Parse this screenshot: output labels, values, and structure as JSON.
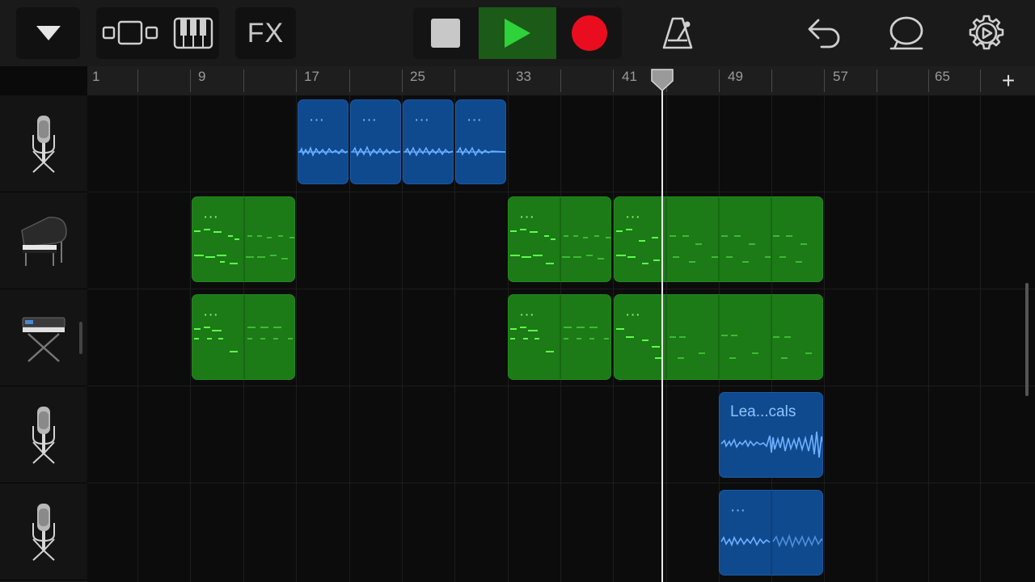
{
  "toolbar": {
    "fx_label": "FX",
    "colors": {
      "play_bg": "#1c5a17",
      "play_icon": "#2ed23a",
      "record": "#ea0d1f",
      "stop": "#c8c8c8"
    }
  },
  "ruler": {
    "bar_numbers": [
      "1",
      "9",
      "17",
      "25",
      "33",
      "41",
      "49",
      "57",
      "65"
    ],
    "add_label": "+"
  },
  "tracks": [
    {
      "instrument": "microphone-icon"
    },
    {
      "instrument": "grand-piano-icon"
    },
    {
      "instrument": "keyboard-synth-icon"
    },
    {
      "instrument": "microphone-icon"
    },
    {
      "instrument": "microphone-icon"
    }
  ],
  "regions": {
    "vocal_1": [
      "···",
      "···",
      "···",
      "···"
    ],
    "piano_a": [
      "···"
    ],
    "piano_b": [
      "···"
    ],
    "piano_c": [
      "···"
    ],
    "synth_a": [
      "···"
    ],
    "synth_b": [
      "···"
    ],
    "synth_c": [
      "···"
    ],
    "lead_vocals": "Lea...cals",
    "vocal_2": "···"
  },
  "playhead": {
    "bar": 44
  }
}
